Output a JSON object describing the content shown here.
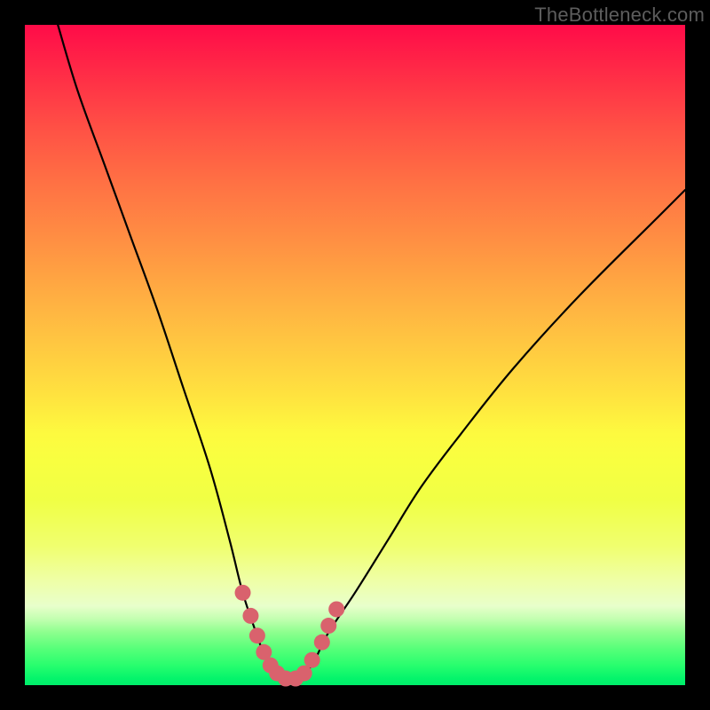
{
  "watermark": "TheBottleneck.com",
  "colors": {
    "frame_bg": "#000000",
    "curve_stroke": "#000000",
    "marker_fill": "#d9626d"
  },
  "chart_data": {
    "type": "line",
    "title": "",
    "xlabel": "",
    "ylabel": "",
    "xlim": [
      0,
      100
    ],
    "ylim": [
      0,
      100
    ],
    "series": [
      {
        "name": "bottleneck-curve",
        "x": [
          5,
          8,
          12,
          16,
          20,
          24,
          28,
          31,
          33,
          35,
          36.5,
          38,
          39.5,
          41,
          42.5,
          44,
          46,
          50,
          55,
          60,
          66,
          74,
          84,
          96,
          100
        ],
        "y": [
          100,
          90,
          79,
          68,
          57,
          45,
          33,
          22,
          14,
          8,
          4,
          1.8,
          1,
          1,
          1.8,
          4,
          8,
          14,
          22,
          30,
          38,
          48,
          59,
          71,
          75
        ]
      }
    ],
    "markers": {
      "name": "highlight-dots",
      "points": [
        {
          "x": 33,
          "y": 14
        },
        {
          "x": 34.2,
          "y": 10.5
        },
        {
          "x": 35.2,
          "y": 7.5
        },
        {
          "x": 36.2,
          "y": 5
        },
        {
          "x": 37.2,
          "y": 3
        },
        {
          "x": 38.2,
          "y": 1.8
        },
        {
          "x": 39.5,
          "y": 1
        },
        {
          "x": 41,
          "y": 1
        },
        {
          "x": 42.3,
          "y": 1.8
        },
        {
          "x": 43.5,
          "y": 3.8
        },
        {
          "x": 45,
          "y": 6.5
        },
        {
          "x": 46,
          "y": 9
        },
        {
          "x": 47.2,
          "y": 11.5
        }
      ]
    }
  }
}
